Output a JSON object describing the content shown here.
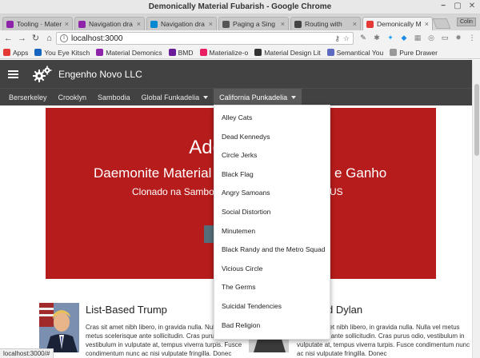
{
  "window": {
    "title": "Demonically Material Fubarish - Google Chrome",
    "controls": [
      "−",
      "▢",
      "✕"
    ]
  },
  "tabs": [
    {
      "label": "Tooling · Mater",
      "color": "#8e24aa"
    },
    {
      "label": "Navigation dra",
      "color": "#8e24aa"
    },
    {
      "label": "Navigation dra",
      "color": "#0288d1"
    },
    {
      "label": "Paging a Sing",
      "color": "#555555"
    },
    {
      "label": "Routing with",
      "color": "#444444"
    },
    {
      "label": "Demonically M",
      "color": "#e53935",
      "active": true
    }
  ],
  "profile": "Colin",
  "omnibox": {
    "url": "localhost:3000"
  },
  "bookmarks": [
    {
      "label": "Apps",
      "color": "#e53935"
    },
    {
      "label": "You Eye Kitsch",
      "color": "#1565c0"
    },
    {
      "label": "Material Demonics",
      "color": "#8e24aa"
    },
    {
      "label": "BMD",
      "color": "#6a1b9a"
    },
    {
      "label": "Materialize-o",
      "color": "#e91e63"
    },
    {
      "label": "Material Design Lit",
      "color": "#333333"
    },
    {
      "label": "Semantical You",
      "color": "#5c6bc0"
    },
    {
      "label": "Pure Drawer",
      "color": "#999999"
    }
  ],
  "app": {
    "brand": "Engenho Novo LLC",
    "nav": [
      {
        "label": "Berserkeley",
        "dropdown": false
      },
      {
        "label": "Crooklyn",
        "dropdown": false
      },
      {
        "label": "Sambodia",
        "dropdown": false
      },
      {
        "label": "Global Funkadelia",
        "dropdown": true
      },
      {
        "label": "California Punkadelia",
        "dropdown": true,
        "open": true
      }
    ],
    "dropdown_items": [
      "Alley Cats",
      "Dead Kennedys",
      "Circle Jerks",
      "Black Flag",
      "Angry Samoans",
      "Social Distortion",
      "Minutemen",
      "Black Randy and the Metro Squad",
      "Vicious Circle",
      "The Germs",
      "Suicidal Tendencies",
      "Bad Religion"
    ]
  },
  "hero": {
    "title_left": "Adeus, M",
    "subtitle_left": "Daemonite Material",
    "subtitle_right": "e Ganho",
    "line3_left": "Clonado na Sambo",
    "line3_right": "US",
    "color": "#b71c1c"
  },
  "cards": [
    {
      "title": "List-Based Trump",
      "text": "Cras sit amet nibh libero, in gravida nulla. Nulla vel metus scelerisque ante sollicitudin. Cras purus odio, vestibulum in vulputate at, tempus viverra turpis. Fusce condimentum nunc ac nisi vulputate fringilla. Donec"
    },
    {
      "title": "d Dylan",
      "text": "Cras sit amet nibh libero, in gravida nulla. Nulla vel metus scelerisque ante sollicitudin. Cras purus odio, vestibulum in vulputate at, tempus viverra turpis. Fusce condimentum nunc ac nisi vulputate fringilla. Donec"
    }
  ],
  "status": "localhost:3000/#"
}
